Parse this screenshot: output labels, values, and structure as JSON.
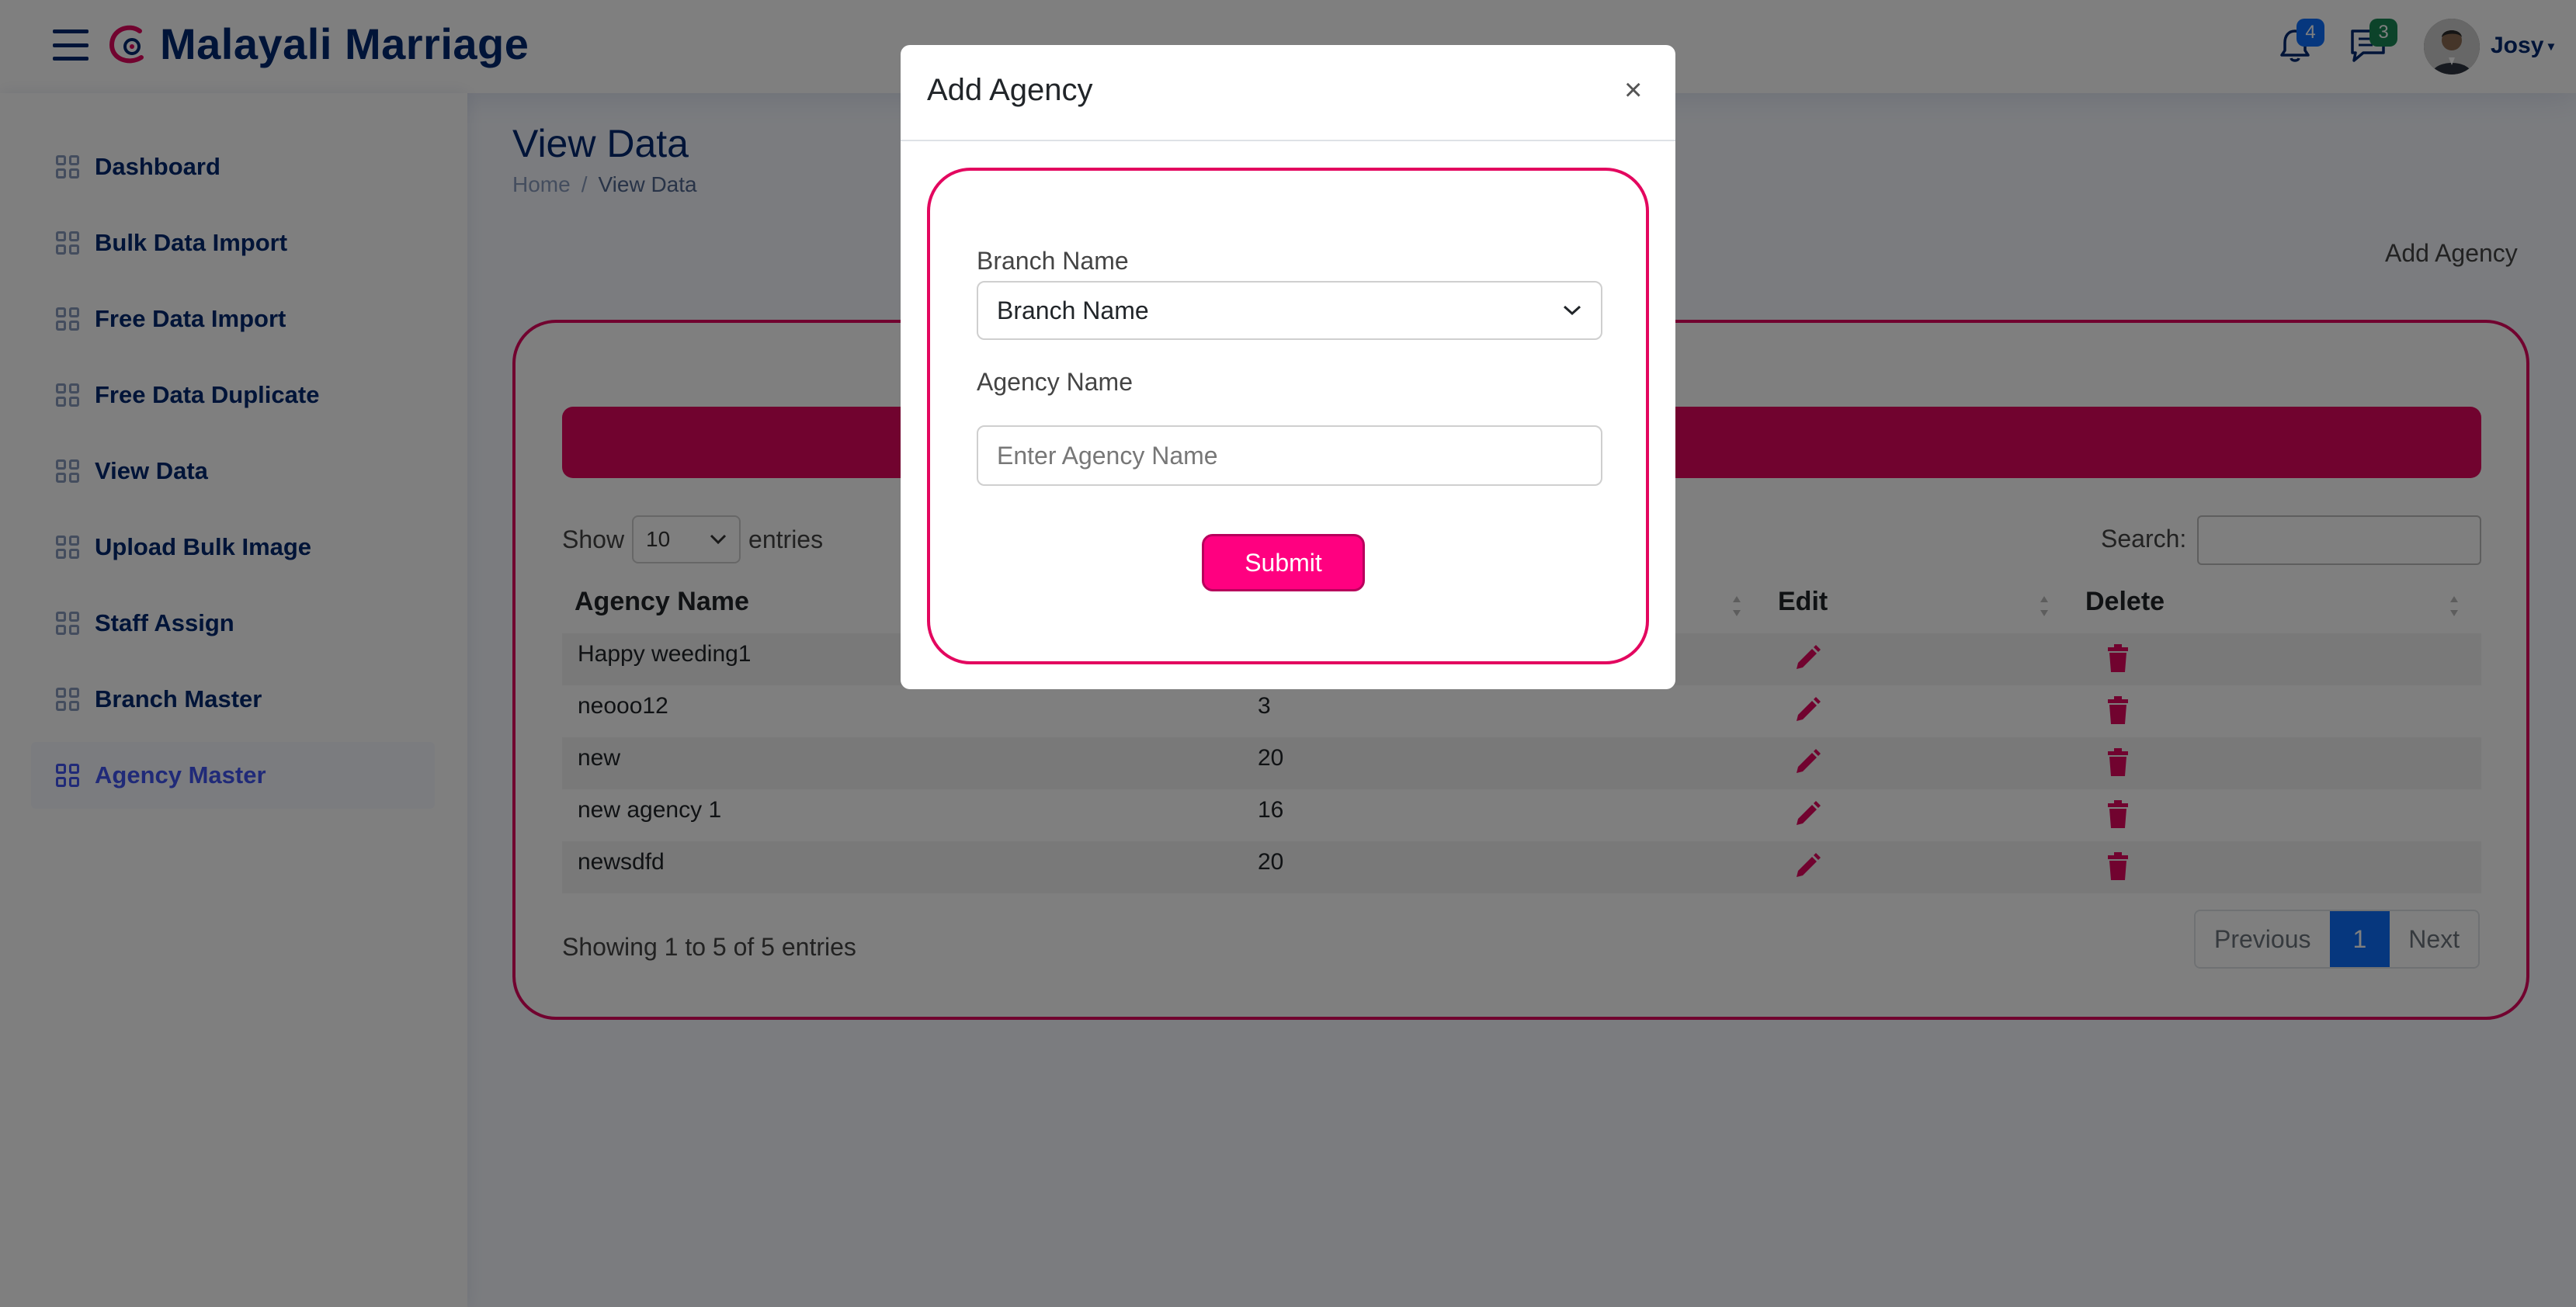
{
  "app": {
    "brand": "Malayali Marriage",
    "notifications_count": "4",
    "messages_count": "3",
    "user_name": "Josy",
    "colors": {
      "primary_pink": "#e3075f",
      "nav_text": "#012970",
      "active_blue": "#4154f1",
      "notif_badge": "#0d6efd",
      "msg_badge": "#198754"
    }
  },
  "sidebar": {
    "items": [
      {
        "label": "Dashboard"
      },
      {
        "label": "Bulk Data Import"
      },
      {
        "label": "Free Data Import"
      },
      {
        "label": "Free Data Duplicate"
      },
      {
        "label": "View Data"
      },
      {
        "label": "Upload Bulk Image"
      },
      {
        "label": "Staff Assign"
      },
      {
        "label": "Branch Master"
      },
      {
        "label": "Agency Master",
        "active": true
      }
    ]
  },
  "page": {
    "title": "View Data",
    "breadcrumb": {
      "home": "Home",
      "separator": "/",
      "current": "View Data"
    },
    "add_link": "Add Agency"
  },
  "table": {
    "show_label": "Show",
    "entries_value": "10",
    "entries_label": "entries",
    "search_label": "Search:",
    "headers": {
      "agency_name": "Agency Name",
      "edit": "Edit",
      "delete": "Delete"
    },
    "rows": [
      {
        "agency_name": "Happy weeding1",
        "count": ""
      },
      {
        "agency_name": "neooo12",
        "count": "3"
      },
      {
        "agency_name": "new",
        "count": "20"
      },
      {
        "agency_name": "new agency 1",
        "count": "16"
      },
      {
        "agency_name": "newsdfd",
        "count": "20"
      }
    ],
    "info": "Showing 1 to 5 of 5 entries",
    "pagination": {
      "previous": "Previous",
      "current": "1",
      "next": "Next"
    }
  },
  "modal": {
    "title": "Add Agency",
    "close": "×",
    "branch_label": "Branch Name",
    "branch_selected": "Branch Name",
    "agency_label": "Agency Name",
    "agency_placeholder": "Enter Agency Name",
    "submit": "Submit"
  }
}
